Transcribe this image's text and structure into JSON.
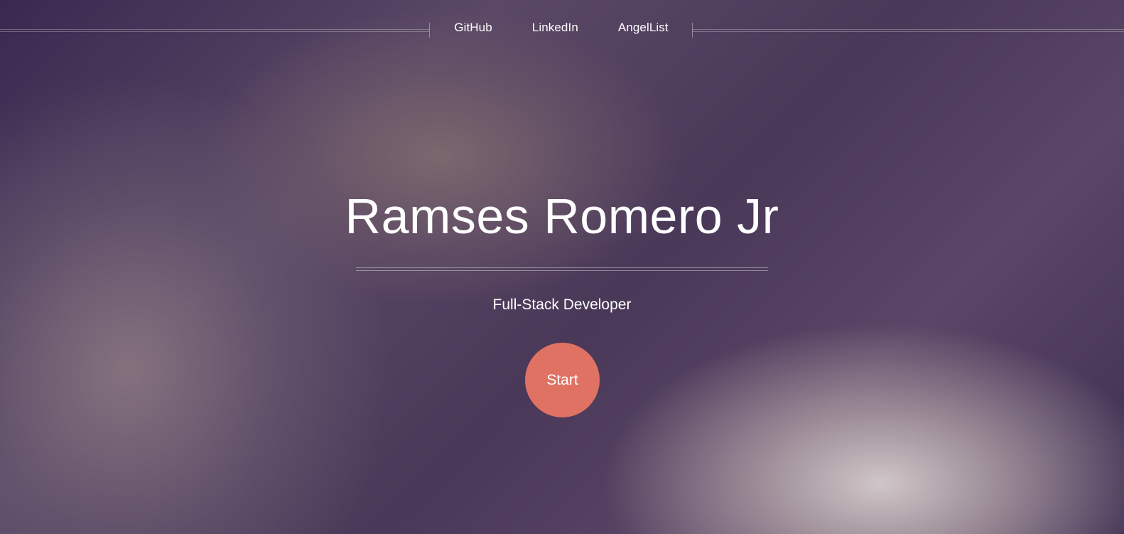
{
  "nav": {
    "links": [
      {
        "label": "GitHub"
      },
      {
        "label": "LinkedIn"
      },
      {
        "label": "AngelList"
      }
    ]
  },
  "hero": {
    "title": "Ramses Romero Jr",
    "subtitle": "Full-Stack Developer",
    "start_label": "Start"
  },
  "colors": {
    "accent": "#e07263",
    "background": "#4b3a5a",
    "text": "#ffffff"
  }
}
